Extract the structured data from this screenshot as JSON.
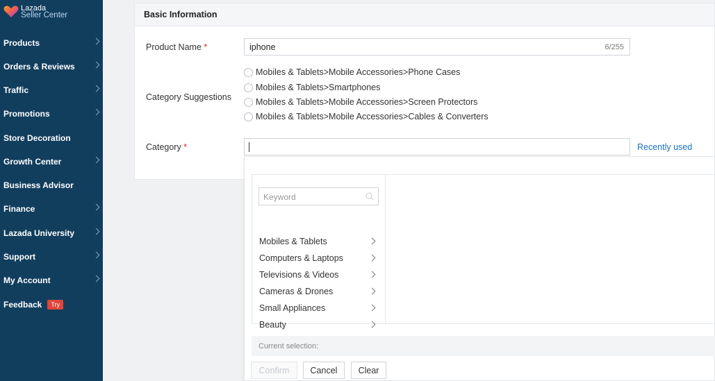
{
  "brand": {
    "line1": "Lazada",
    "line2": "Seller Center"
  },
  "sidebar": {
    "items": [
      {
        "label": "Products",
        "has_chevron": true
      },
      {
        "label": "Orders & Reviews",
        "has_chevron": true
      },
      {
        "label": "Traffic",
        "has_chevron": true
      },
      {
        "label": "Promotions",
        "has_chevron": true
      },
      {
        "label": "Store Decoration",
        "has_chevron": false
      },
      {
        "label": "Growth Center",
        "has_chevron": true
      },
      {
        "label": "Business Advisor",
        "has_chevron": false
      },
      {
        "label": "Finance",
        "has_chevron": true
      },
      {
        "label": "Lazada University",
        "has_chevron": true
      },
      {
        "label": "Support",
        "has_chevron": true
      },
      {
        "label": "My Account",
        "has_chevron": true
      },
      {
        "label": "Feedback",
        "has_chevron": false,
        "badge": "Try"
      }
    ]
  },
  "form": {
    "section_title": "Basic Information",
    "product_name_label": "Product Name",
    "required_mark": "*",
    "product_name_value": "iphone",
    "product_name_counter": "6/255",
    "category_suggestions_label": "Category Suggestions",
    "suggestions": [
      "Mobiles & Tablets>Mobile Accessories>Phone Cases",
      "Mobiles & Tablets>Smartphones",
      "Mobiles & Tablets>Mobile Accessories>Screen Protectors",
      "Mobiles & Tablets>Mobile Accessories>Cables & Converters"
    ],
    "category_label": "Category",
    "category_value": "",
    "recently_used": "Recently used"
  },
  "category_picker": {
    "keyword_placeholder": "Keyword",
    "categories": [
      "Mobiles & Tablets",
      "Computers & Laptops",
      "Televisions & Videos",
      "Cameras & Drones",
      "Small Appliances",
      "Beauty"
    ],
    "current_selection_label": "Current selection:",
    "buttons": {
      "confirm": "Confirm",
      "cancel": "Cancel",
      "clear": "Clear"
    }
  },
  "colors": {
    "sidebar_bg": "#123e5e",
    "link": "#1a71c4",
    "required": "#e02020",
    "badge": "#e0453a"
  }
}
